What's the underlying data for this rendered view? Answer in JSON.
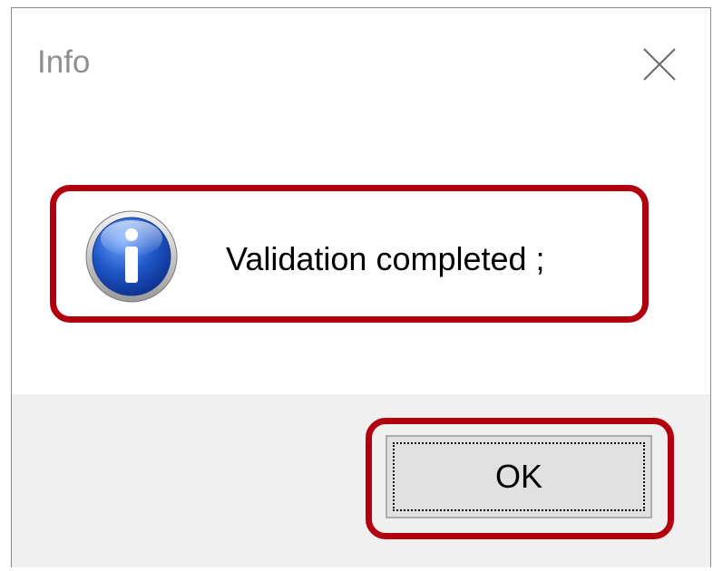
{
  "dialog": {
    "title": "Info",
    "message": "Validation completed ;",
    "ok_label": "OK",
    "icon": "info-icon",
    "close_icon": "close-icon"
  },
  "colors": {
    "highlight": "#b3000f",
    "title_text": "#8f8f8f",
    "footer_bg": "#f0f0f0",
    "button_bg": "#e1e1e1"
  }
}
